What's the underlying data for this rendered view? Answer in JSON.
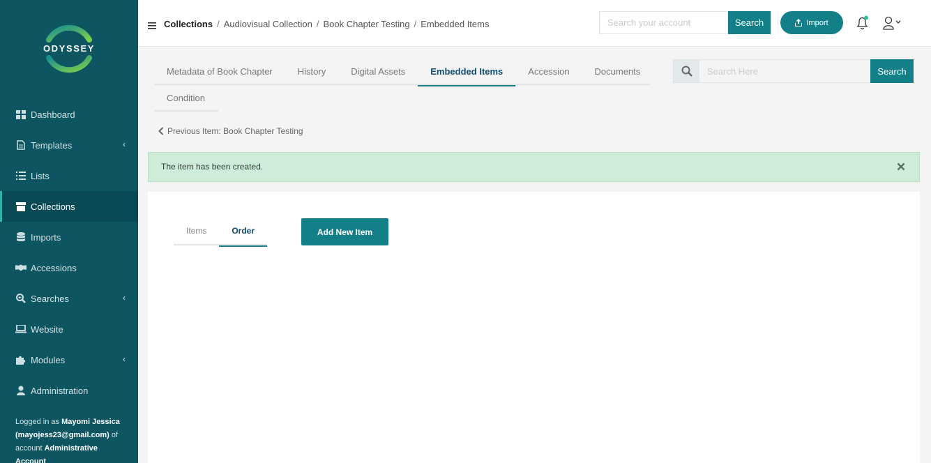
{
  "brand": {
    "logo_text": "ODYSSEY",
    "ring_colors": [
      "#1a8f8f",
      "#7ed04a"
    ]
  },
  "sidebar": {
    "items": [
      {
        "label": "Dashboard",
        "icon": "dashboard-icon",
        "has_submenu": false,
        "active": false
      },
      {
        "label": "Templates",
        "icon": "document-icon",
        "has_submenu": true,
        "active": false
      },
      {
        "label": "Lists",
        "icon": "list-icon",
        "has_submenu": false,
        "active": false
      },
      {
        "label": "Collections",
        "icon": "archive-box-icon",
        "has_submenu": false,
        "active": true
      },
      {
        "label": "Imports",
        "icon": "database-icon",
        "has_submenu": false,
        "active": false
      },
      {
        "label": "Accessions",
        "icon": "handshake-icon",
        "has_submenu": false,
        "active": false
      },
      {
        "label": "Searches",
        "icon": "search-plus-icon",
        "has_submenu": true,
        "active": false
      },
      {
        "label": "Website",
        "icon": "laptop-icon",
        "has_submenu": false,
        "active": false
      },
      {
        "label": "Modules",
        "icon": "puzzle-icon",
        "has_submenu": true,
        "active": false
      },
      {
        "label": "Administration",
        "icon": "user-icon",
        "has_submenu": false,
        "active": false
      }
    ],
    "login": {
      "prefix": "Logged in as ",
      "name": "Mayomi Jessica (mayojess23@gmail.com)",
      "middle": " of account ",
      "account": "Administrative Account"
    }
  },
  "header": {
    "breadcrumb": [
      "Collections",
      "Audiovisual Collection",
      "Book Chapter Testing",
      "Embedded Items"
    ],
    "search_placeholder": "Search your account",
    "search_button": "Search",
    "import_button": "Import"
  },
  "tabs": {
    "items": [
      "Metadata of Book Chapter",
      "History",
      "Digital Assets",
      "Embedded Items",
      "Accession",
      "Documents"
    ],
    "active": "Embedded Items",
    "second_row": "Condition"
  },
  "right_search": {
    "placeholder": "Search Here",
    "button": "Search"
  },
  "previous_item": "Previous Item: Book Chapter Testing",
  "alert": {
    "message": "The item has been created."
  },
  "panel": {
    "subtabs": [
      "Items",
      "Order"
    ],
    "active_subtab": "Order",
    "add_button": "Add New Item"
  },
  "colors": {
    "sidebar_bg": "#0d5560",
    "accent": "#127f89",
    "alert_bg": "#cfecd9"
  }
}
